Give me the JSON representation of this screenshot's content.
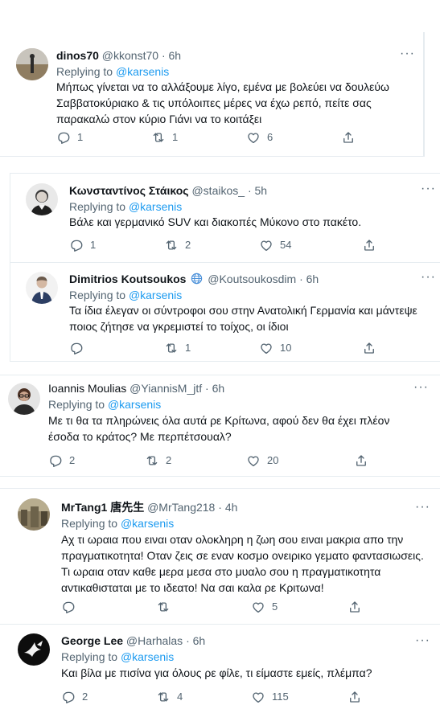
{
  "tweets": [
    {
      "display_name": "dinos70",
      "handle": "@kkonst70",
      "dot": "·",
      "time": "6h",
      "replying_prefix": "Replying to",
      "replying_to": "@karsenis",
      "text": "Μήπως γίνεται να το αλλάξουμε λίγο, εμένα με βολεύει να δουλεύω Σαββατοκύριακο & τις υπόλοιπες μέρες να έχω ρεπό, πείτε σας παρακαλώ στον κύριο Γιάνι να το κοιτάξει",
      "replies": "1",
      "retweets": "1",
      "likes": "6",
      "more": "···"
    },
    {
      "display_name": "Κωνσταντίνος Στάικος",
      "handle": "@staikos_",
      "dot": "·",
      "time": "5h",
      "replying_prefix": "Replying to",
      "replying_to": "@karsenis",
      "text": "Βάλε και γερμανικό SUV και διακοπές Μύκονο στο πακέτο.",
      "replies": "1",
      "retweets": "2",
      "likes": "54",
      "more": "···"
    },
    {
      "display_name": "Dimitrios Koutsoukos",
      "handle": "@Koutsoukosdim",
      "dot": "·",
      "time": "6h",
      "replying_prefix": "Replying to",
      "replying_to": "@karsenis",
      "text": "Τα ίδια έλεγαν οι σύντροφοι σου στην Ανατολική Γερμανία και μάντεψε ποιος ζήτησε να γκρεμιστεί το τοίχος, οι ίδιοι",
      "replies": "",
      "retweets": "1",
      "likes": "10",
      "more": "···"
    },
    {
      "display_name": "Ioannis Moulias",
      "handle": "@YiannisM_jtf",
      "dot": "·",
      "time": "6h",
      "replying_prefix": "Replying to",
      "replying_to": "@karsenis",
      "text": "Με τι θα τα πληρώνεις όλα αυτά ρε Κρίτωνα, αφού δεν θα έχει πλέον έσοδα το κράτος? Με περπέτσουαλ?",
      "replies": "2",
      "retweets": "2",
      "likes": "20",
      "more": "···"
    },
    {
      "display_name": "MrTang1 唐先生",
      "handle": "@MrTang218",
      "dot": "·",
      "time": "4h",
      "replying_prefix": "Replying to",
      "replying_to": "@karsenis",
      "text": "Αχ τι ωραια που ειναι οταν ολοκληρη η ζωη σου ειναι μακρια απο την πραγματικοτητα! Οταν ζεις σε εναν κοσμο ονειρικο γεματο φαντασιωσεις. Τι ωραια οταν καθε μερα μεσα στο μυαλο σου η πραγματικοτητα αντικαθισταται με το ιδεατο! Να σαι καλα ρε Κριτωνα!",
      "replies": "",
      "retweets": "",
      "likes": "5",
      "more": "···"
    },
    {
      "display_name": "George Lee",
      "handle": "@Harhalas",
      "dot": "·",
      "time": "6h",
      "replying_prefix": "Replying to",
      "replying_to": "@karsenis",
      "text": "Και βίλα με πισίνα για όλους ρε φίλε, τι είμαστε εμείς, πλέμπα?",
      "replies": "2",
      "retweets": "4",
      "likes": "115",
      "more": "···"
    }
  ],
  "icons": {
    "reply": "reply-icon",
    "retweet": "retweet-icon",
    "like": "heart-icon",
    "share": "share-icon",
    "more": "more-icon",
    "verified": "globe-badge-icon"
  },
  "colors": {
    "text": "#0f1419",
    "muted": "#536471",
    "link": "#1d9bf0",
    "border": "#e6ecf0"
  }
}
